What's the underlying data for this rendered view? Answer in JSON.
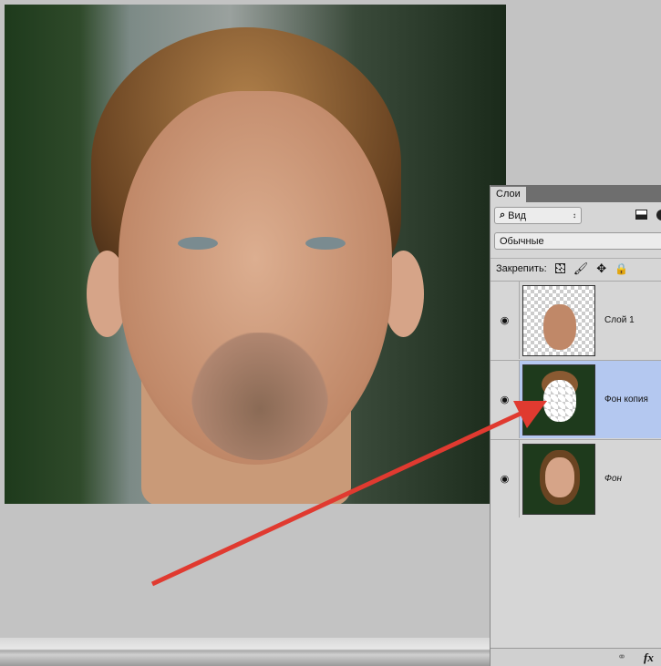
{
  "panel": {
    "tab": "Слои",
    "filter_label": "Вид",
    "blend_mode": "Обычные",
    "lock_label": "Закрепить:",
    "layers": [
      {
        "name": "Слой 1",
        "visible": true,
        "selected": false
      },
      {
        "name": "Фон копия",
        "visible": true,
        "selected": true
      },
      {
        "name": "Фон",
        "visible": true,
        "selected": false
      }
    ],
    "footer_icons": [
      "link-icon",
      "fx-icon"
    ],
    "fx_label": "fx"
  },
  "colors": {
    "selected_row": "#b4c8f0",
    "arrow": "#e03a30"
  }
}
